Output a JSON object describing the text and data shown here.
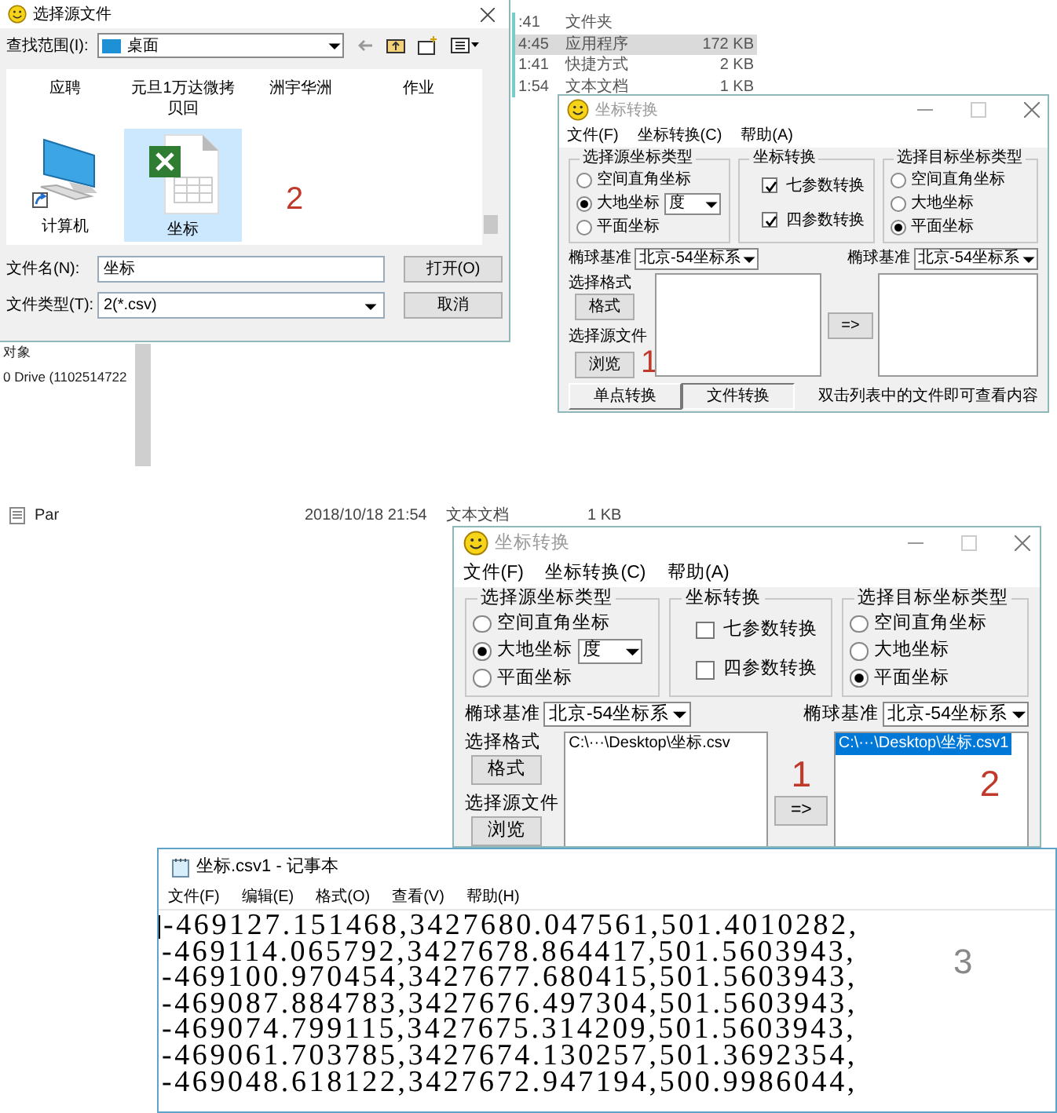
{
  "file_dialog": {
    "title": "选择源文件",
    "look_in_label": "查找范围(I):",
    "look_in_value": "桌面",
    "folder_labels": [
      "应聘",
      "元旦1万达微拷贝回",
      "洲宇华洲",
      "作业"
    ],
    "items": [
      {
        "kind": "computer",
        "label": "计算机",
        "selected": false
      },
      {
        "kind": "spreadsheet",
        "label": "坐标",
        "selected": true
      }
    ],
    "filename_label": "文件名(N):",
    "filename_value": "坐标",
    "filetype_label": "文件类型(T):",
    "filetype_value": "2(*.csv)",
    "open_button": "打开(O)",
    "cancel_button": "取消",
    "annotation": "2"
  },
  "explorer_top": {
    "rows": [
      {
        "time": ":41",
        "type": "文件夹",
        "selected": false
      },
      {
        "time": "4:45",
        "type": "应用程序",
        "size": "172 KB",
        "selected": true
      },
      {
        "time": "1:41",
        "type": "快捷方式",
        "size": "2 KB",
        "selected": false
      },
      {
        "time": "1:54",
        "type": "文本文档",
        "size": "1 KB",
        "selected": false
      }
    ]
  },
  "explorer_side": {
    "items": [
      "对象",
      "0 Drive (1102514722"
    ]
  },
  "explorer_row": {
    "name": "Par",
    "date": "2018/10/18 21:54",
    "type": "文本文档",
    "size": "1 KB"
  },
  "converters": [
    {
      "title": "坐标转换",
      "menu": [
        "文件(F)",
        "坐标转换(C)",
        "帮助(A)"
      ],
      "source": {
        "legend": "选择源坐标类型",
        "options": [
          {
            "label": "空间直角坐标",
            "selected": false
          },
          {
            "label": "大地坐标",
            "selected": true,
            "unit": "度"
          },
          {
            "label": "平面坐标",
            "selected": false
          }
        ]
      },
      "transform": {
        "legend": "坐标转换",
        "options": [
          {
            "label": "七参数转换",
            "checked": true
          },
          {
            "label": "四参数转换",
            "checked": true
          }
        ]
      },
      "target": {
        "legend": "选择目标坐标类型",
        "options": [
          {
            "label": "空间直角坐标",
            "selected": false
          },
          {
            "label": "大地坐标",
            "selected": false
          },
          {
            "label": "平面坐标",
            "selected": true
          }
        ]
      },
      "source_ellipsoid": {
        "label": "椭球基准",
        "value": "北京-54坐标系"
      },
      "target_ellipsoid": {
        "label": "椭球基准",
        "value": "北京-54坐标系"
      },
      "format_label": "选择格式",
      "format_button": "格式",
      "file_label": "选择源文件",
      "browse_button": "浏览",
      "convert_button": "=>",
      "mode_tabs": [
        {
          "label": "单点转换",
          "selected": false
        },
        {
          "label": "文件转换",
          "selected": true
        }
      ],
      "hint": "双击列表中的文件即可查看内容",
      "annotations": [
        {
          "text": "1",
          "kind": "browse"
        }
      ]
    },
    {
      "title": "坐标转换",
      "menu": [
        "文件(F)",
        "坐标转换(C)",
        "帮助(A)"
      ],
      "source": {
        "legend": "选择源坐标类型",
        "options": [
          {
            "label": "空间直角坐标",
            "selected": false
          },
          {
            "label": "大地坐标",
            "selected": true,
            "unit": "度"
          },
          {
            "label": "平面坐标",
            "selected": false
          }
        ]
      },
      "transform": {
        "legend": "坐标转换",
        "options": [
          {
            "label": "七参数转换",
            "checked": false
          },
          {
            "label": "四参数转换",
            "checked": false
          }
        ]
      },
      "target": {
        "legend": "选择目标坐标类型",
        "options": [
          {
            "label": "空间直角坐标",
            "selected": false
          },
          {
            "label": "大地坐标",
            "selected": false
          },
          {
            "label": "平面坐标",
            "selected": true
          }
        ]
      },
      "source_ellipsoid": {
        "label": "椭球基准",
        "value": "北京-54坐标系"
      },
      "target_ellipsoid": {
        "label": "椭球基准",
        "value": "北京-54坐标系"
      },
      "format_label": "选择格式",
      "format_button": "格式",
      "file_label": "选择源文件",
      "browse_button": "浏览",
      "convert_button": "=>",
      "source_files": [
        {
          "path": "C:\\···\\Desktop\\坐标.csv",
          "selected": false
        }
      ],
      "target_files": [
        {
          "path": "C:\\···\\Desktop\\坐标.csv1",
          "selected": true
        }
      ],
      "annotations": [
        {
          "text": "1",
          "kind": "middle"
        },
        {
          "text": "2",
          "kind": "target"
        }
      ]
    }
  ],
  "notepad": {
    "title": "坐标.csv1 - 记事本",
    "menu": [
      "文件(F)",
      "编辑(E)",
      "格式(O)",
      "查看(V)",
      "帮助(H)"
    ],
    "lines": [
      "-469127.151468,3427680.047561,501.4010282,",
      "-469114.065792,3427678.864417,501.5603943,",
      "-469100.970454,3427677.680415,501.5603943,",
      "-469087.884783,3427676.497304,501.5603943,",
      "-469074.799115,3427675.314209,501.5603943,",
      "-469061.703785,3427674.130257,501.3692354,",
      "-469048.618122,3427672.947194,500.9986044,"
    ],
    "annotation": "3"
  }
}
